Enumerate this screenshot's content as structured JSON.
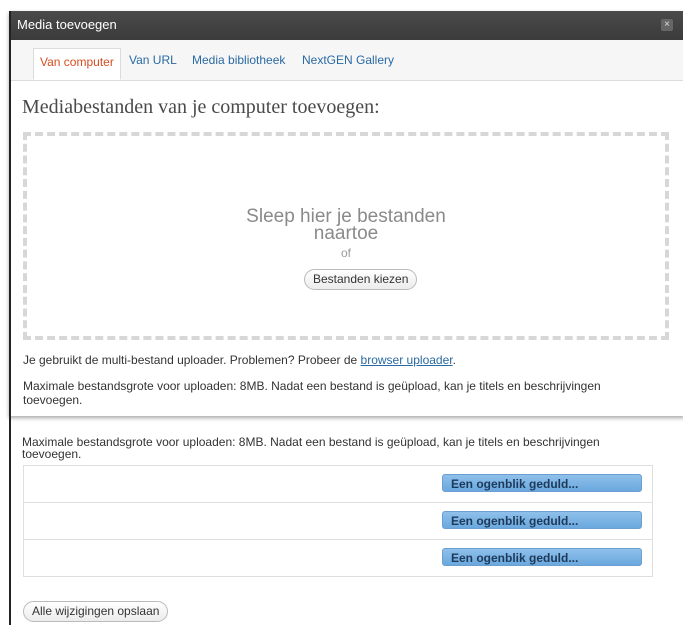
{
  "dialog": {
    "title": "Media toevoegen",
    "close_glyph": "×"
  },
  "tabs": [
    {
      "label": "Van computer",
      "active": true
    },
    {
      "label": "Van URL",
      "active": false
    },
    {
      "label": "Media bibliotheek",
      "active": false
    },
    {
      "label": "NextGEN Gallery",
      "active": false
    }
  ],
  "upload": {
    "heading": "Mediabestanden van je computer toevoegen:",
    "drop_line1": "Sleep hier je bestanden",
    "drop_line2": "naartoe",
    "or_text": "of",
    "choose_button": "Bestanden kiezen",
    "info_prefix": "Je gebruikt de multi-bestand uploader. Problemen? Probeer de ",
    "info_link": "browser uploader",
    "info_suffix": ".",
    "max_size_info": "Maximale bestandsgrote voor uploaden: 8MB. Nadat een bestand is geüpload, kan je titels en beschrijvingen toevoegen."
  },
  "lower": {
    "max_size_info": "Maximale bestandsgrote voor uploaden: 8MB. Nadat een bestand is geüpload, kan je titels en beschrijvingen toevoegen.",
    "queue": [
      {
        "status": "Een ogenblik geduld..."
      },
      {
        "status": "Een ogenblik geduld..."
      },
      {
        "status": "Een ogenblik geduld..."
      }
    ],
    "save_button": "Alle wijzigingen opslaan"
  },
  "colors": {
    "title_bar": "#444444",
    "active_tab": "#d54e21",
    "link": "#2a6aa3",
    "progress_button": "#7ab3e4"
  }
}
